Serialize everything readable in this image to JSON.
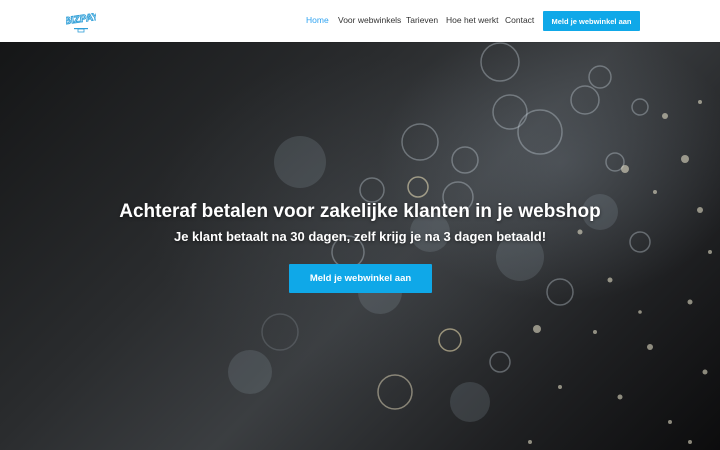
{
  "header": {
    "logo_text": "BIZPAY",
    "nav": [
      {
        "label": "Home",
        "active": true
      },
      {
        "label": "Voor webwinkels",
        "active": false
      },
      {
        "label": "Tarieven",
        "active": false
      },
      {
        "label": "Hoe het werkt",
        "active": false
      },
      {
        "label": "Contact",
        "active": false
      }
    ],
    "cta_label": "Meld je webwinkel aan"
  },
  "hero": {
    "title": "Achteraf betalen voor zakelijke klanten in je webshop",
    "subtitle": "Je klant betaalt na 30 dagen, zelf krijg je na 3 dagen betaald!",
    "cta_label": "Meld je webwinkel aan"
  },
  "colors": {
    "accent": "#0fa8e8",
    "nav_active": "#2ea3f2",
    "nav_text": "#333333",
    "logo": "#2f9fd8"
  }
}
